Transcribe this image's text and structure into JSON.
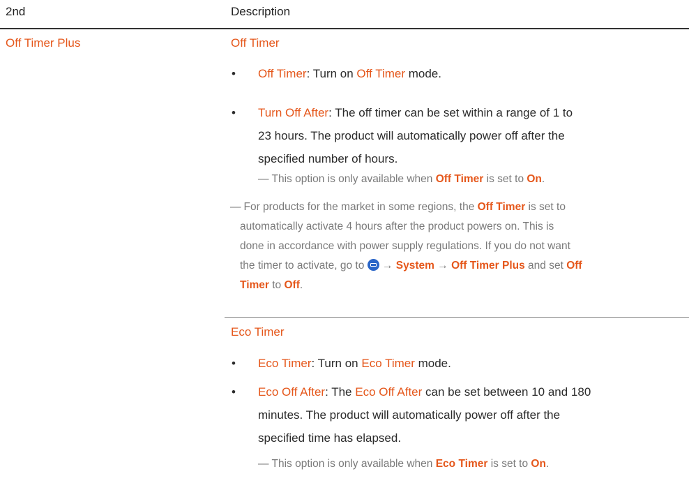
{
  "header": {
    "col1": "2nd",
    "col2": "Description"
  },
  "row": {
    "left_label": "Off Timer Plus",
    "off_timer": {
      "title": "Off Timer",
      "bullet1": {
        "term": "Off Timer",
        "text1": ": Turn on ",
        "term2": "Off Timer",
        "text2": " mode."
      },
      "bullet2": {
        "term": "Turn Off After",
        "line1": ": The off timer can be set within a range of 1 to",
        "line2": "23 hours. The product will automatically power off after the",
        "line3": "specified number of hours."
      },
      "note": {
        "dash": "―",
        "text1": "This option is only available when ",
        "term": "Off Timer",
        "text2": " is set to ",
        "term2": "On",
        "text3": "."
      },
      "region_note": {
        "dash": "―",
        "l1a": "For products for the market in some regions, the ",
        "l1term": "Off Timer",
        "l1b": " is set to",
        "l2": "automatically activate 4 hours after the product powers on. This is",
        "l3": "done in accordance with power supply regulations. If you do not want",
        "l4a": "the timer to activate, go to ",
        "arrow": "→",
        "system": "System",
        "path2": "Off Timer Plus",
        "l4b": " and set ",
        "l4term": "Off",
        "l5term": "Timer",
        "l5a": " to ",
        "l5off": "Off",
        "l5b": "."
      }
    },
    "eco_timer": {
      "title": "Eco Timer",
      "bullet1": {
        "term": "Eco Timer",
        "text1": ": Turn on ",
        "term2": "Eco Timer",
        "text2": " mode."
      },
      "bullet2": {
        "term": "Eco Off After",
        "l1a": ": The ",
        "l1term": "Eco Off After",
        "l1b": " can be set between 10 and 180",
        "line2": "minutes. The product will automatically power off after the",
        "line3": "specified time has elapsed."
      },
      "note": {
        "dash": "―",
        "text1": "This option is only available when ",
        "term": "Eco Timer",
        "text2": " is set to ",
        "term2": "On",
        "text3": "."
      }
    },
    "bullet_char": "•"
  },
  "colors": {
    "accent": "#e5571b",
    "note_gray": "#7a7a7a",
    "text": "#2b2b2b",
    "icon_blue": "#2a66c8"
  },
  "icons": {
    "menu": "menu-icon"
  }
}
